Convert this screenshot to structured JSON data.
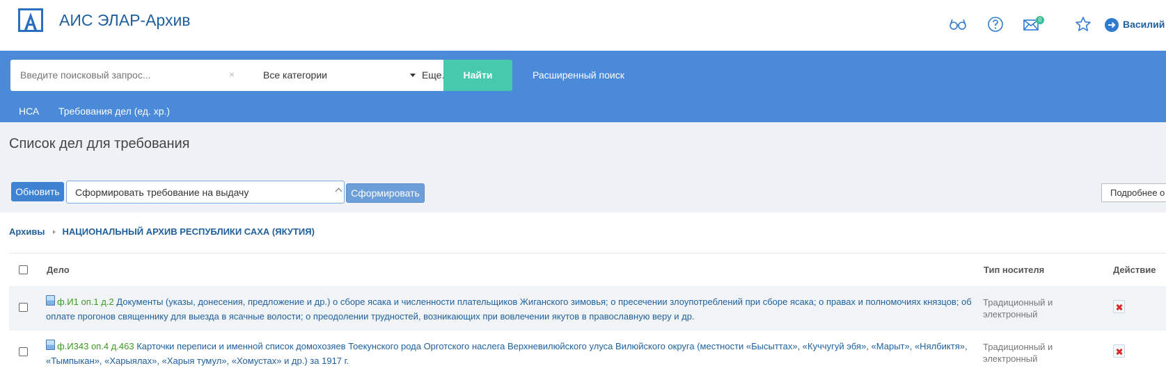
{
  "header": {
    "app_title": "АИС ЭЛАР-Архив",
    "mail_badge": "0",
    "user_name": "Василий А",
    "icons": [
      "glasses-icon",
      "help-icon",
      "mail-icon",
      "star-icon",
      "login-icon"
    ]
  },
  "search": {
    "placeholder": "Введите поисковый запрос...",
    "clear_label": "×",
    "category": "Все категории",
    "more_label": "Еще...",
    "find_label": "Найти",
    "advanced_label": "Расширенный поиск"
  },
  "subnav": {
    "items": [
      {
        "label": "НСА"
      },
      {
        "label": "Требования дел (ед. хр.)"
      }
    ]
  },
  "toolbar": {
    "page_title": "Список дел для требования",
    "refresh_label": "Обновить",
    "action_select_value": "Сформировать требование на выдачу",
    "form_label": "Сформировать",
    "more_label": "Подробнее о"
  },
  "breadcrumb": {
    "root": "Архивы",
    "current": "НАЦИОНАЛЬНЫЙ АРХИВ РЕСПУБЛИКИ САХА (ЯКУТИЯ)"
  },
  "table": {
    "headers": {
      "doc": "Дело",
      "media": "Тип носителя",
      "action": "Действие"
    },
    "rows": [
      {
        "ref": "ф.И1 оп.1 д.2",
        "description": "Документы (указы, донесения, предложение и др.) о сборе ясака и численности плательщиков Жиганского зимовья; о пресечении злоупотреблений при сборе ясака; о правах и полномочиях князцов; об оплате прогонов священнику для выезда в ясачные волости; о преодолении трудностей, возникающих при вовлечении якутов в православную веру и др.",
        "media": "Традиционный и электронный"
      },
      {
        "ref": "ф.И343 оп.4 д.463",
        "description": "Карточки переписи и именной список домохозяев Тоекунского рода Орготского наслега Верхневилюйского улуса Вилюйского округа (местности «Бысыттах», «Куччугуй эбя», «Марыт», «Нялбиктя», «Тымпыкан», «Харыялах», «Харыя тумул», «Хомустах» и др.) за 1917 г.",
        "media": "Традиционный и электронный"
      }
    ]
  },
  "colors": {
    "band": "#4a8ad8",
    "find_button": "#46c9ad",
    "link": "#1f5f9c",
    "ref": "#3c9a1e",
    "delete": "#d62626"
  }
}
